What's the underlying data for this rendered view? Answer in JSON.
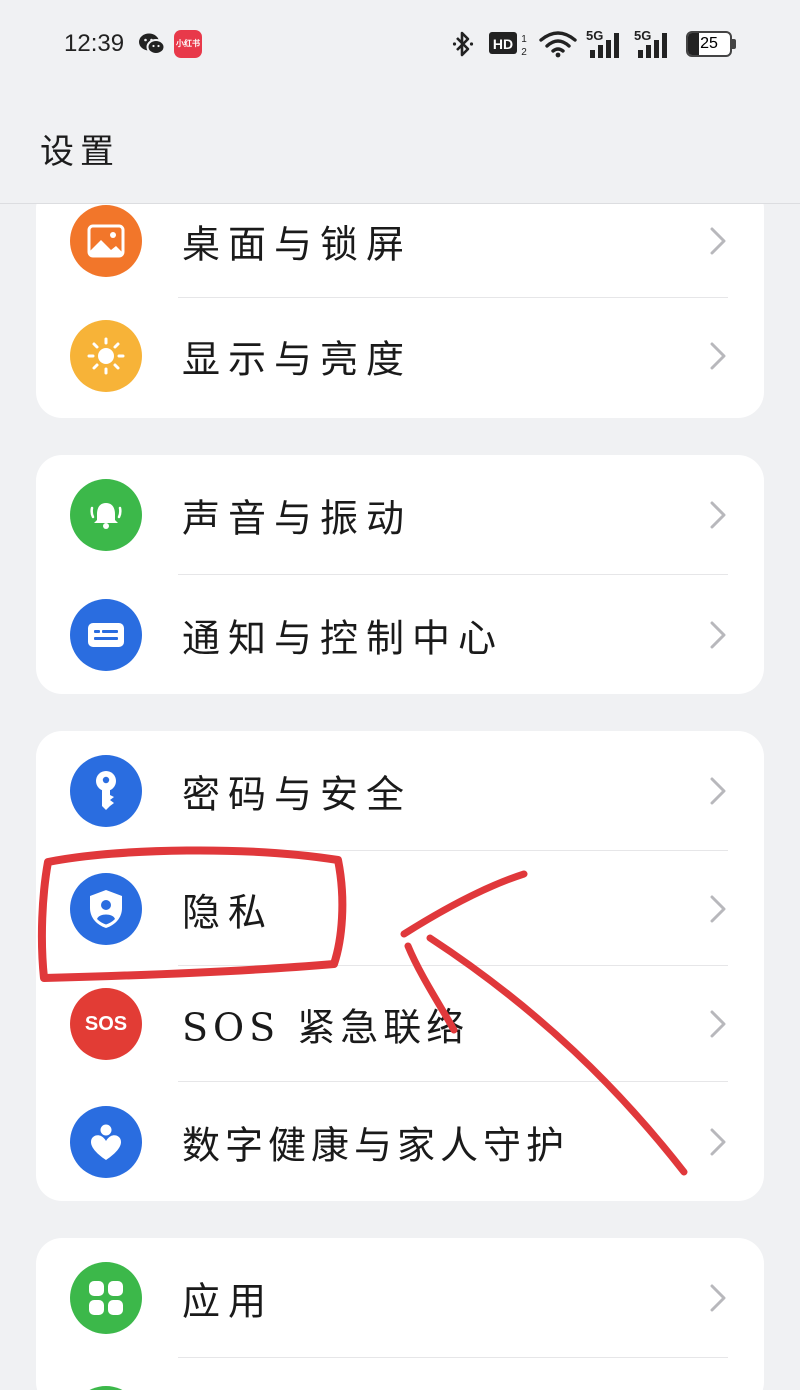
{
  "status_bar": {
    "time": "12:39",
    "network_hd": "HD",
    "signal_1": "5G",
    "signal_2": "5G",
    "battery_level": "25",
    "battery_fraction": 0.25,
    "rednote_label": "小红书",
    "icons": [
      "wechat-icon",
      "rednote-icon",
      "bluetooth-icon",
      "hd-icon",
      "wifi-icon",
      "signal-5g-icon",
      "signal-5g-icon",
      "battery-icon"
    ]
  },
  "header": {
    "title": "设置"
  },
  "groups": [
    {
      "items": [
        {
          "label": "桌面与锁屏",
          "icon": "wallpaper-icon",
          "color": "#f2762a"
        },
        {
          "label": "显示与亮度",
          "icon": "sun-icon",
          "color": "#f7b338"
        }
      ]
    },
    {
      "items": [
        {
          "label": "声音与振动",
          "icon": "bell-icon",
          "color": "#3cb84a"
        },
        {
          "label": "通知与控制中心",
          "icon": "notification-icon",
          "color": "#2a6de0"
        }
      ]
    },
    {
      "items": [
        {
          "label": "密码与安全",
          "icon": "key-icon",
          "color": "#2a6de0"
        },
        {
          "label": "隐私",
          "icon": "privacy-shield-icon",
          "color": "#2a6de0"
        },
        {
          "label": "SOS 紧急联络",
          "icon": "sos-icon",
          "icon_text": "SOS",
          "color": "#e23c35"
        },
        {
          "label": "数字健康与家人守护",
          "icon": "family-heart-icon",
          "color": "#2a6de0"
        }
      ]
    },
    {
      "items": [
        {
          "label": "应用",
          "icon": "apps-grid-icon",
          "color": "#3cb84a"
        }
      ]
    }
  ],
  "colors": {
    "background": "#f0f1f3",
    "card": "#ffffff",
    "annotation": "#e0383b",
    "chevron": "#b8b8bc"
  }
}
